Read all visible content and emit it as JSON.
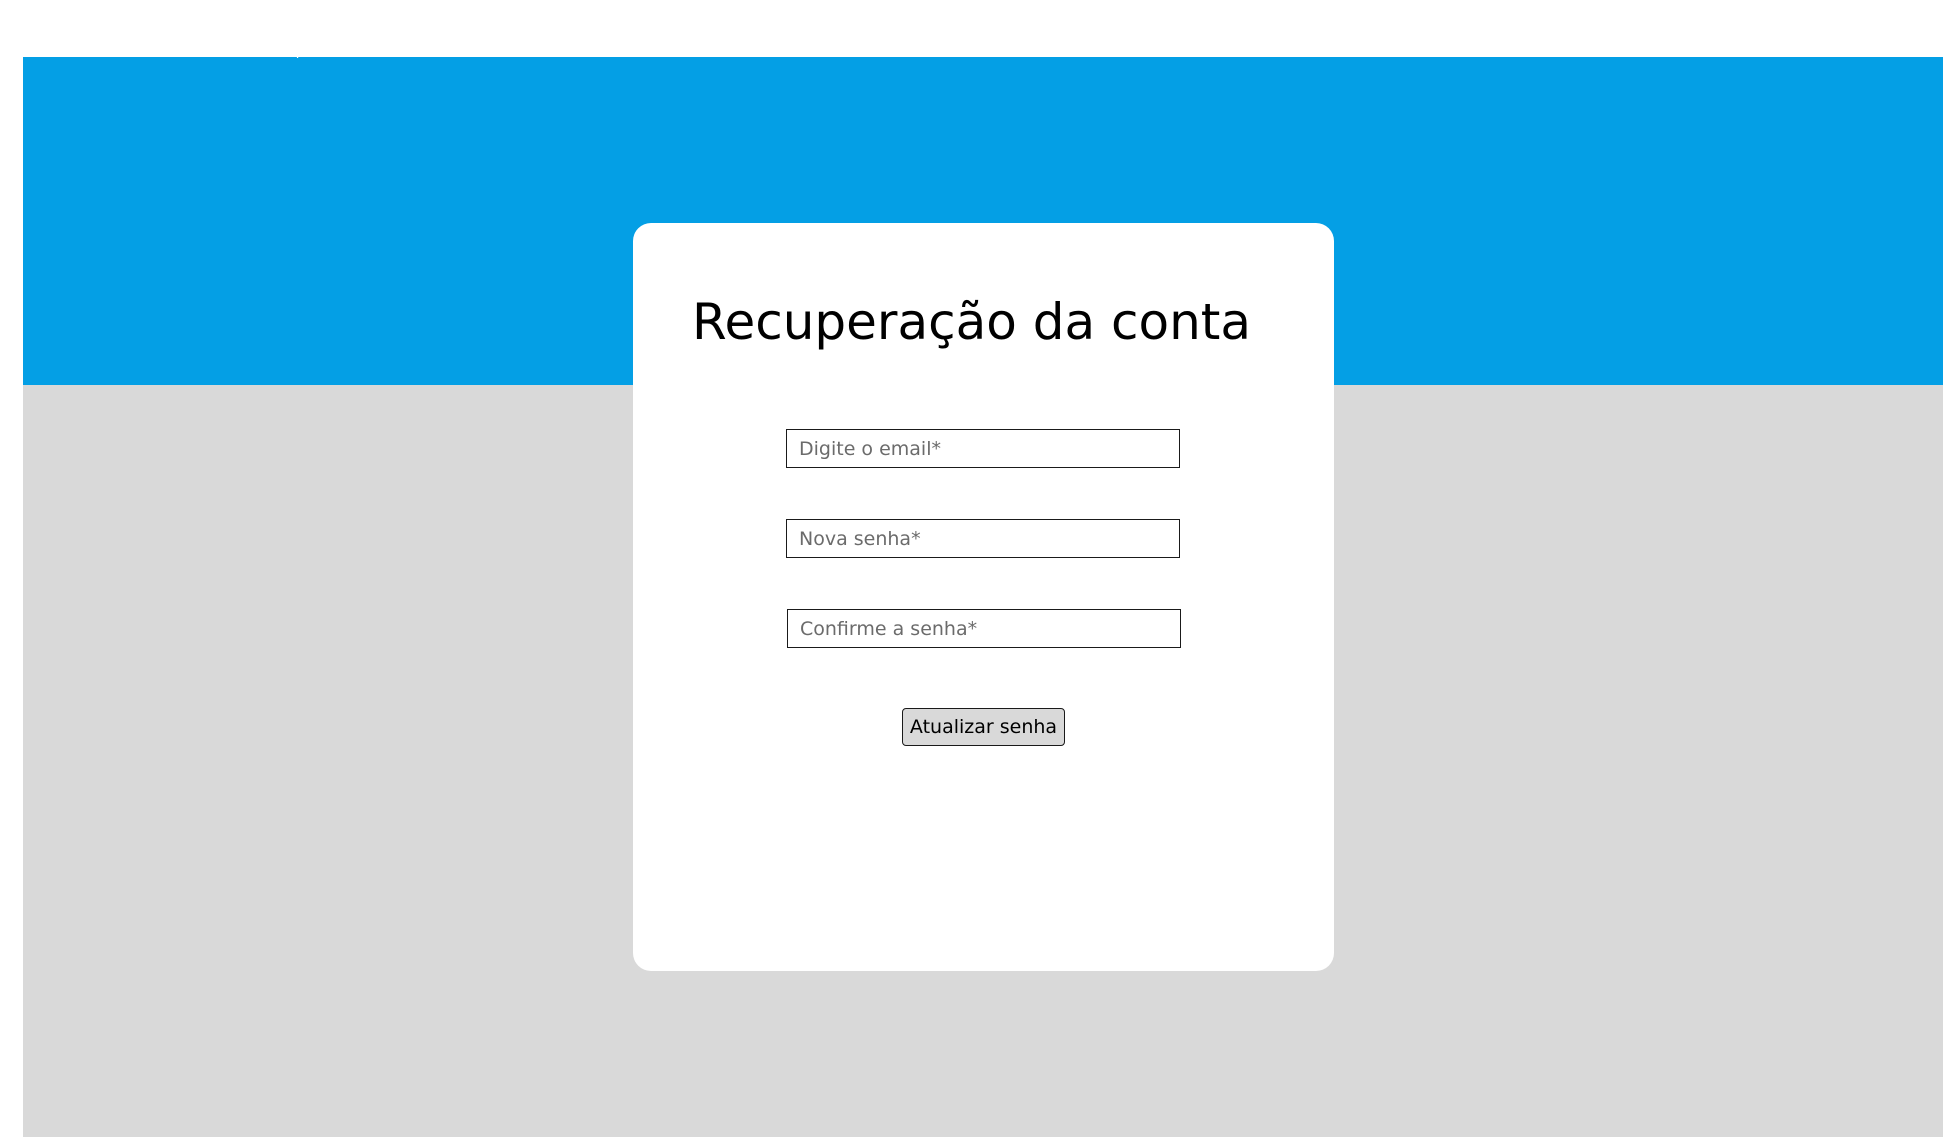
{
  "colors": {
    "header_band": "#049fe5",
    "background": "#d9d9d9",
    "card": "#ffffff",
    "button": "#d9d9d9"
  },
  "recovery_form": {
    "title": "Recuperação da conta",
    "email_placeholder": "Digite o email*",
    "email_value": "",
    "new_password_placeholder": "Nova senha*",
    "new_password_value": "",
    "confirm_password_placeholder": "Confirme a senha*",
    "confirm_password_value": "",
    "submit_label": "Atualizar senha"
  }
}
